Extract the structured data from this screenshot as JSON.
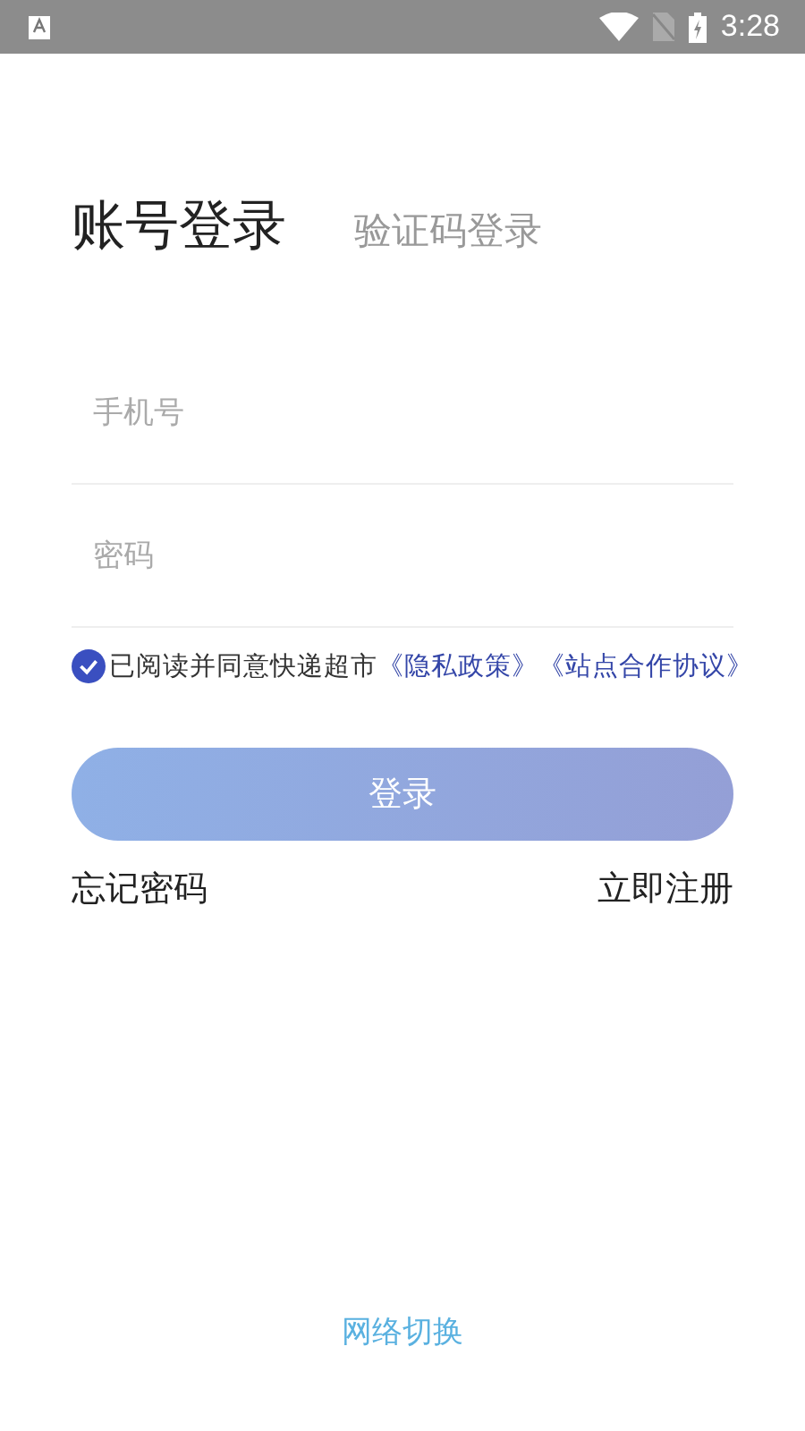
{
  "status_bar": {
    "time": "3:28"
  },
  "tabs": [
    {
      "label": "账号登录",
      "selected": true
    },
    {
      "label": "验证码登录",
      "selected": false
    }
  ],
  "fields": [
    {
      "placeholder": "手机号"
    },
    {
      "placeholder": "密码"
    }
  ],
  "agreement": {
    "checked": true,
    "text": "已阅读并同意快递超市",
    "links": [
      "《隐私政策》",
      "《站点合作协议》"
    ]
  },
  "login_button": "登录",
  "links": {
    "forgot": "忘记密码",
    "register": "立即注册"
  },
  "footer_link": "网络切换"
}
